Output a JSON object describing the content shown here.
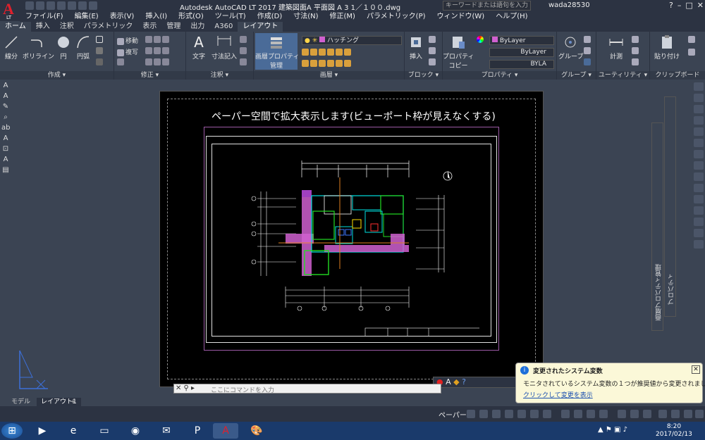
{
  "titlebar": {
    "title": "Autodesk AutoCAD LT 2017    建築図面A    平面図    A 3    1／１００.dwg",
    "search_placeholder": "キーワードまたは語句を入力",
    "user": "wada28530",
    "logo_sub": "LT"
  },
  "menu": [
    "ファイル(F)",
    "編集(E)",
    "表示(V)",
    "挿入(I)",
    "形式(O)",
    "ツール(T)",
    "作成(D)",
    "寸法(N)",
    "修正(M)",
    "パラメトリック(P)",
    "ウィンドウ(W)",
    "ヘルプ(H)"
  ],
  "tabs": [
    "ホーム",
    "挿入",
    "注釈",
    "パラメトリック",
    "表示",
    "管理",
    "出力",
    "A360",
    "レイアウト"
  ],
  "ribbon": {
    "draw": {
      "title": "作成 ▾",
      "line": "線分",
      "polyline": "ポリライン",
      "circle": "円",
      "arc": "円弧"
    },
    "modify": {
      "title": "修正 ▾",
      "move": "移動",
      "copy": "複写"
    },
    "annotation": {
      "title": "注釈 ▾",
      "text": "文字",
      "dimension": "寸法記入"
    },
    "layers": {
      "title": "画層 ▾",
      "layer_props": "画層プロパティ",
      "manage": "管理",
      "current_layer": "ハッチング"
    },
    "block": {
      "title": "ブロック ▾",
      "insert": "挿入"
    },
    "properties": {
      "title": "プロパティ ▾",
      "props": "プロパティ",
      "copy": "コピー",
      "color": "ByLayer",
      "linetype": "ByLayer",
      "lineweight": "BYLA"
    },
    "groups": {
      "title": "グループ ▾",
      "group": "グループ"
    },
    "utilities": {
      "title": "ユーティリティ ▾",
      "measure": "計測"
    },
    "clipboard": {
      "title": "クリップボード",
      "paste": "貼り付け"
    }
  },
  "canvas": {
    "caption": "ペーパー空間で拡大表示します(ビューポート枠が見えなくする)"
  },
  "palettes": {
    "layer_props": "画層プロパティ管理",
    "properties": "プロパティ"
  },
  "command": {
    "placeholder": "ここにコマンドを入力"
  },
  "layout_tabs": [
    "モデル",
    "レイアウト1",
    "+"
  ],
  "status": {
    "paper": "ペーパー"
  },
  "notification": {
    "title": "変更されたシステム変数",
    "message": "モニタされているシステム変数の１つが推奨値から変更されました",
    "link": "クリックして変更を表示"
  },
  "taskbar": {
    "time": "8:20",
    "date": "2017/02/13"
  },
  "colors": {
    "accent": "#1e6fd9",
    "logo_red": "#e0202c",
    "viewport_purple": "#9c5aa6",
    "hatch_magenta": "#d060d0"
  }
}
